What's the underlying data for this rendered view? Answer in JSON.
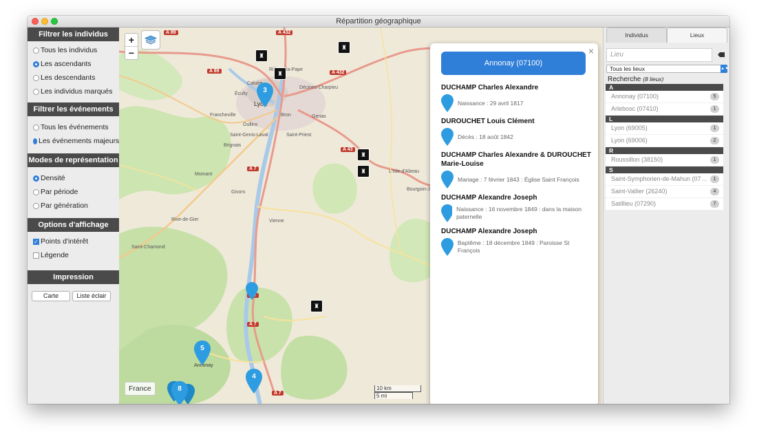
{
  "window": {
    "title": "Répartition géographique"
  },
  "sidebar": {
    "filter_individuals": {
      "header": "Filtrer les individus",
      "options": [
        "Tous les individus",
        "Les ascendants",
        "Les descendants",
        "Les individus marqués"
      ],
      "selected": 1
    },
    "filter_events": {
      "header": "Filtrer les événements",
      "options": [
        "Tous les événements",
        "Les événements majeurs"
      ],
      "selected": 1
    },
    "modes": {
      "header": "Modes de représentation",
      "options": [
        "Densité",
        "Par période",
        "Par génération"
      ],
      "selected": 0
    },
    "display": {
      "header": "Options d'affichage",
      "options": [
        {
          "label": "Points d'intérêt",
          "checked": true
        },
        {
          "label": "Légende",
          "checked": false
        }
      ]
    },
    "print": {
      "header": "Impression",
      "buttons": [
        "Carte",
        "Liste éclair"
      ]
    }
  },
  "map": {
    "zoom_in": "+",
    "zoom_out": "−",
    "country_label": "France",
    "scale": {
      "km": "10 km",
      "mi": "5 mi"
    },
    "roads": [
      "A 89",
      "A 432",
      "A 89",
      "A 432",
      "A 43",
      "A 7",
      "A 7",
      "A 7",
      "A 7"
    ],
    "places": [
      "Rillieux-la-Pape",
      "Caluire",
      "Écully",
      "Lyon",
      "Décines-Charpieu",
      "Bron",
      "Genas",
      "Francheville",
      "Oullins",
      "Saint-Genis-Laval",
      "Saint-Priest",
      "Brignais",
      "Momant",
      "Givors",
      "L'Isle-d'Abeau",
      "Bourgoin-Jallieu",
      "Rive-de-Gier",
      "Vienne",
      "Saint-Chamond",
      "Annonay"
    ],
    "clusters": [
      {
        "count": "3"
      },
      {
        "count": ""
      },
      {
        "count": "5"
      },
      {
        "count": "8"
      },
      {
        "count": "4"
      }
    ]
  },
  "popup": {
    "title": "Annonay (07100)",
    "close": "×",
    "events": [
      {
        "person": "DUCHAMP Charles Alexandre",
        "text": "Naissance : 29 avril 1817"
      },
      {
        "person": "DUROUCHET Louis Clément",
        "text": "Décès : 18 août 1842"
      },
      {
        "person": "DUCHAMP Charles Alexandre & DUROUCHET Marie-Louise",
        "text": "Mariage : 7 février 1843 : Église Saint François"
      },
      {
        "person": "DUCHAMP Alexandre Joseph",
        "text": "Naissance : 16 novembre 1849 : dans la maison paternelle"
      },
      {
        "person": "DUCHAMP Alexandre Joseph",
        "text": "Baptême : 18 décembre 1849 : Paroisse St François"
      }
    ]
  },
  "rpanel": {
    "tabs": [
      "Individus",
      "Lieux"
    ],
    "active_tab": 1,
    "search_placeholder": "Lieu",
    "select_value": "Tous les lieux",
    "recherche": "Recherche",
    "recherche_count": "(8 lieux)",
    "groups": [
      {
        "letter": "A",
        "items": [
          {
            "name": "Annonay (07100)",
            "count": "5"
          },
          {
            "name": "Arlebosc (07410)",
            "count": "1"
          }
        ]
      },
      {
        "letter": "L",
        "items": [
          {
            "name": "Lyon (69005)",
            "count": "1"
          },
          {
            "name": "Lyon (69006)",
            "count": "2"
          }
        ]
      },
      {
        "letter": "R",
        "items": [
          {
            "name": "Roussillon (38150)",
            "count": "1"
          }
        ]
      },
      {
        "letter": "S",
        "items": [
          {
            "name": "Saint-Symphorien-de-Mahun (07…",
            "count": "1"
          },
          {
            "name": "Saint-Vallier (26240)",
            "count": "4"
          },
          {
            "name": "Satillieu (07290)",
            "count": "7"
          }
        ]
      }
    ]
  }
}
